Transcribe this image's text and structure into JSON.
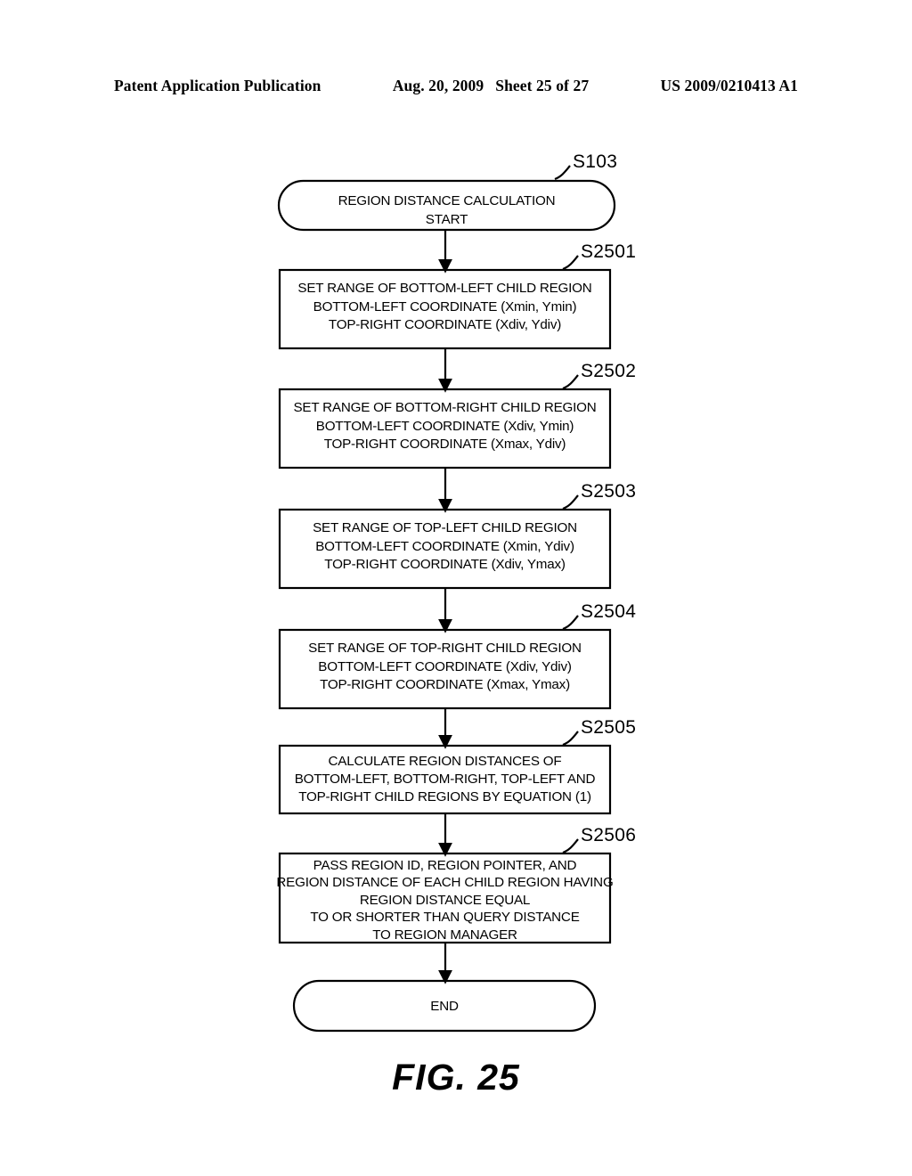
{
  "header": {
    "publication": "Patent Application Publication",
    "date": "Aug. 20, 2009",
    "sheet": "Sheet 25 of 27",
    "number": "US 2009/0210413 A1"
  },
  "figure": {
    "caption": "FIG. 25"
  },
  "flowchart": {
    "start": {
      "label": "S103",
      "lines": [
        "REGION DISTANCE CALCULATION",
        "START"
      ]
    },
    "steps": [
      {
        "label": "S2501",
        "lines": [
          "SET RANGE OF BOTTOM-LEFT CHILD REGION",
          "BOTTOM-LEFT COORDINATE (Xmin, Ymin)",
          "TOP-RIGHT COORDINATE (Xdiv, Ydiv)"
        ]
      },
      {
        "label": "S2502",
        "lines": [
          "SET RANGE OF BOTTOM-RIGHT CHILD REGION",
          "BOTTOM-LEFT COORDINATE (Xdiv, Ymin)",
          "TOP-RIGHT COORDINATE (Xmax, Ydiv)"
        ]
      },
      {
        "label": "S2503",
        "lines": [
          "SET RANGE OF TOP-LEFT CHILD REGION",
          "BOTTOM-LEFT COORDINATE (Xmin, Ydiv)",
          "TOP-RIGHT COORDINATE (Xdiv, Ymax)"
        ]
      },
      {
        "label": "S2504",
        "lines": [
          "SET RANGE OF TOP-RIGHT CHILD REGION",
          "BOTTOM-LEFT COORDINATE (Xdiv, Ydiv)",
          "TOP-RIGHT COORDINATE (Xmax, Ymax)"
        ]
      },
      {
        "label": "S2505",
        "lines": [
          "CALCULATE REGION DISTANCES OF",
          "BOTTOM-LEFT, BOTTOM-RIGHT, TOP-LEFT AND",
          "TOP-RIGHT CHILD REGIONS BY EQUATION (1)"
        ]
      },
      {
        "label": "S2506",
        "lines": [
          "PASS REGION ID, REGION POINTER, AND",
          "REGION DISTANCE OF EACH CHILD REGION HAVING",
          "REGION DISTANCE EQUAL",
          "TO OR SHORTER THAN QUERY DISTANCE",
          "TO REGION MANAGER"
        ]
      }
    ],
    "end": {
      "lines": [
        "END"
      ]
    }
  }
}
